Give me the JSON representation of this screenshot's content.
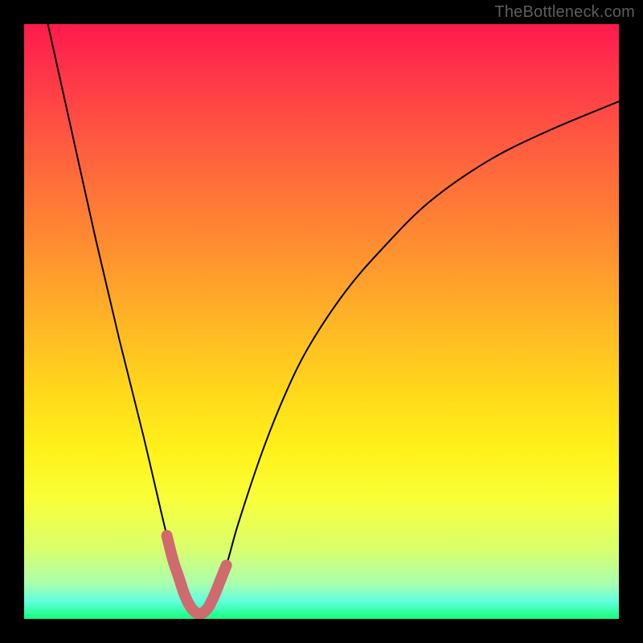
{
  "watermark": "TheBottleneck.com",
  "chart_data": {
    "type": "line",
    "title": "",
    "xlabel": "",
    "ylabel": "",
    "xlim": [
      0,
      100
    ],
    "ylim": [
      0,
      100
    ],
    "series": [
      {
        "name": "bottleneck-curve",
        "x": [
          4,
          8,
          12,
          16,
          20,
          24,
          26,
          27,
          28,
          29,
          30,
          31,
          32,
          34,
          36,
          40,
          44,
          48,
          54,
          60,
          68,
          78,
          88,
          100
        ],
        "values": [
          100,
          82,
          64,
          47,
          31,
          14,
          7,
          4,
          2,
          1,
          1,
          2,
          4,
          9,
          16,
          28,
          38,
          46,
          55,
          62,
          70,
          77,
          82,
          87
        ]
      },
      {
        "name": "highlight-region",
        "x": [
          24,
          25,
          26,
          27,
          28,
          29,
          30,
          31,
          32,
          33,
          34
        ],
        "values": [
          14,
          10,
          7,
          4,
          2,
          1,
          1,
          2,
          4,
          6.5,
          9
        ]
      }
    ],
    "colors": {
      "curve": "#000000",
      "highlight": "#cf6a6f",
      "background_top": "#ff1a4d",
      "background_bottom": "#13ff7a"
    }
  }
}
